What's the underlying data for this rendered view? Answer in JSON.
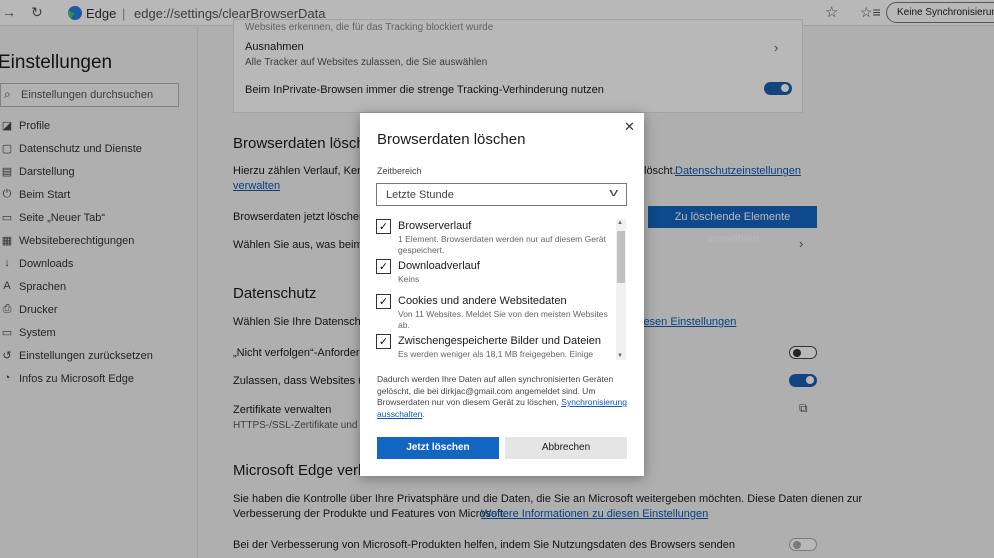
{
  "browser": {
    "back_icon": "arrow-left-icon",
    "reload_icon": "reload-icon",
    "edge_label": "Edge",
    "separator": "|",
    "url": "edge://settings/clearBrowserData",
    "sync_label": "Keine Synchronisierung"
  },
  "sidebar": {
    "title": "Einstellungen",
    "search_placeholder": "Einstellungen durchsuchen",
    "items": [
      {
        "label": "Profile",
        "icon": "profile-icon"
      },
      {
        "label": "Datenschutz und Dienste",
        "icon": "lock-icon"
      },
      {
        "label": "Darstellung",
        "icon": "appearance-icon"
      },
      {
        "label": "Beim Start",
        "icon": "power-icon"
      },
      {
        "label": "Seite „Neuer Tab“",
        "icon": "new-tab-icon"
      },
      {
        "label": "Websiteberechtigungen",
        "icon": "permissions-icon"
      },
      {
        "label": "Downloads",
        "icon": "download-icon"
      },
      {
        "label": "Sprachen",
        "icon": "language-icon"
      },
      {
        "label": "Drucker",
        "icon": "printer-icon"
      },
      {
        "label": "System",
        "icon": "system-icon"
      },
      {
        "label": "Einstellungen zurücksetzen",
        "icon": "reset-icon"
      },
      {
        "label": "Infos zu Microsoft Edge",
        "icon": "edge-icon"
      }
    ]
  },
  "main": {
    "top_partial": "Websites erkennen, die für das Tracking blockiert wurde",
    "exceptions_title": "Ausnahmen",
    "exceptions_desc": "Alle Tracker auf Websites zulassen, die Sie auswählen",
    "inprivate_label": "Beim InPrivate-Browsen immer die strenge Tracking-Verhinderung nutzen",
    "browserdata_heading": "Browserdaten lösch",
    "browserdata_desc": "Hierzu zählen Verlauf, Kennw",
    "browserdata_desc_end": "löscht.",
    "privacy_settings_link": "Datenschutzeinstellungen",
    "manage_link": "verwalten",
    "clear_now_label": "Browserdaten jetzt löschen",
    "choose_button": "Zu löschende Elemente auswählen",
    "choose_each_close": "Wählen Sie aus, was beim Sc",
    "privacy_heading": "Datenschutz",
    "privacy_desc": "Wählen Sie Ihre Datenschutz",
    "privacy_link_end": "iesen Einstellungen",
    "dnt_label": "„Nicht verfolgen“-Anforder",
    "allow_sites_label": "Zulassen, dass Websites übe",
    "certs_title": "Zertifikate verwalten",
    "certs_desc": "HTTPS-/SSL-Zertifikate und -Einst",
    "ms_heading": "Microsoft Edge verb",
    "ms_desc1": "Sie haben die Kontrolle über Ihre Privatsphäre und die Daten, die Sie an Microsoft weitergeben möchten. Diese Daten dienen zur",
    "ms_desc2": "Verbesserung der Produkte und Features von Microsoft.",
    "ms_link": "Weitere Informationen zu diesen Einstellungen",
    "improve_label": "Bei der Verbesserung von Microsoft-Produkten helfen, indem Sie Nutzungsdaten des Browsers senden"
  },
  "dialog": {
    "title": "Browserdaten löschen",
    "close_icon": "close-icon",
    "range_label": "Zeitbereich",
    "range_value": "Letzte Stunde",
    "options": [
      {
        "name": "Browserverlauf",
        "desc": "1 Element. Browserdaten werden nur auf diesem Gerät gespeichert.",
        "checked": true
      },
      {
        "name": "Downloadverlauf",
        "desc": "Keins",
        "checked": true
      },
      {
        "name": "Cookies und andere Websitedaten",
        "desc": "Von 11 Websites. Meldet Sie von den meisten Websites ab.",
        "checked": true
      },
      {
        "name": "Zwischengespeicherte Bilder und Dateien",
        "desc": "Es werden weniger als 18,1 MB freigegeben. Einige",
        "checked": true
      }
    ],
    "info_text": "Dadurch werden Ihre Daten auf allen synchronisierten Geräten gelöscht, die bei dirkjac@gmail.com angemeldet sind. Um Browserdaten nur von diesem Gerät zu löschen,",
    "info_link": "Synchronisierung ausschalten",
    "info_end": ".",
    "primary_button": "Jetzt löschen",
    "cancel_button": "Abbrechen"
  }
}
